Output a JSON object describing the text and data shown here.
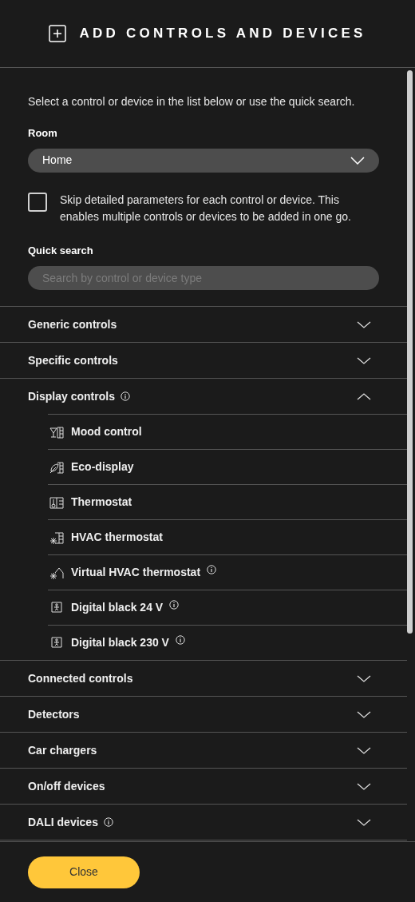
{
  "header": {
    "title": "ADD CONTROLS AND DEVICES"
  },
  "intro": "Select a control or device in the list below or use the quick search.",
  "room": {
    "label": "Room",
    "value": "Home"
  },
  "skip_option": {
    "label": "Skip detailed parameters for each control or device. This enables multiple controls or devices to be added in one go.",
    "checked": false
  },
  "quick_search": {
    "label": "Quick search",
    "placeholder": "Search by control or device type"
  },
  "categories": [
    {
      "label": "Generic controls",
      "info": false,
      "expanded": false
    },
    {
      "label": "Specific controls",
      "info": false,
      "expanded": false
    },
    {
      "label": "Display controls",
      "info": true,
      "expanded": true,
      "children": [
        {
          "label": "Mood control",
          "kind": "mood",
          "info": false
        },
        {
          "label": "Eco-display",
          "kind": "eco",
          "info": false
        },
        {
          "label": "Thermostat",
          "kind": "thermostat",
          "info": false
        },
        {
          "label": "HVAC thermostat",
          "kind": "hvac",
          "info": false
        },
        {
          "label": "Virtual HVAC thermostat",
          "kind": "virtual",
          "info": true
        },
        {
          "label": "Digital black 24 V",
          "kind": "digital",
          "info": true
        },
        {
          "label": "Digital black 230 V",
          "kind": "digital",
          "info": true
        }
      ]
    },
    {
      "label": "Connected controls",
      "info": false,
      "expanded": false
    },
    {
      "label": "Detectors",
      "info": false,
      "expanded": false
    },
    {
      "label": "Car chargers",
      "info": false,
      "expanded": false
    },
    {
      "label": "On/off devices",
      "info": false,
      "expanded": false
    },
    {
      "label": "DALI devices",
      "info": true,
      "expanded": false
    }
  ],
  "footer": {
    "close": "Close"
  }
}
